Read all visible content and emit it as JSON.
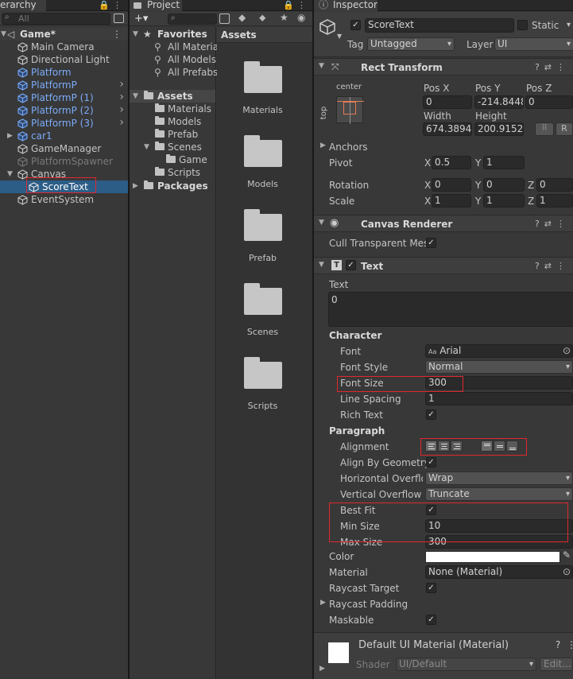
{
  "hierarchy": {
    "tab_label": "erarchy",
    "search_placeholder": "All",
    "scene_name": "Game*",
    "items": [
      {
        "label": "Main Camera",
        "style": "normal"
      },
      {
        "label": "Directional Light",
        "style": "normal"
      },
      {
        "label": "Platform",
        "style": "blue"
      },
      {
        "label": "PlatformP",
        "style": "blue"
      },
      {
        "label": "PlatformP (1)",
        "style": "blue"
      },
      {
        "label": "PlatformP (2)",
        "style": "blue"
      },
      {
        "label": "PlatformP (3)",
        "style": "blue"
      },
      {
        "label": "car1",
        "style": "blue"
      },
      {
        "label": "GameManager",
        "style": "normal"
      },
      {
        "label": "PlatformSpawner",
        "style": "grey"
      },
      {
        "label": "Canvas",
        "style": "normal"
      },
      {
        "label": "ScoreText",
        "style": "selected"
      },
      {
        "label": "EventSystem",
        "style": "normal"
      }
    ]
  },
  "project": {
    "tab_label": "Project",
    "add_label": "+▾",
    "favorites_label": "Favorites",
    "favorites": [
      "All Materia",
      "All Models",
      "All Prefabs"
    ],
    "assets_label": "Assets",
    "asset_folders": [
      "Materials",
      "Models",
      "Prefab",
      "Scenes",
      "Game",
      "Scripts"
    ],
    "packages_label": "Packages",
    "breadcrumb": "Assets",
    "grid_folders": [
      "Materials",
      "Models",
      "Prefab",
      "Scenes",
      "Scripts"
    ]
  },
  "inspector": {
    "tab_label": "Inspector",
    "object_name": "ScoreText",
    "static_label": "Static",
    "tag_label": "Tag",
    "tag_value": "Untagged",
    "layer_label": "Layer",
    "layer_value": "UI",
    "rect_transform": {
      "title": "Rect Transform",
      "anchor_h": "center",
      "anchor_v": "top",
      "posx_label": "Pos X",
      "posx": "0",
      "posy_label": "Pos Y",
      "posy": "-214.8448",
      "posz_label": "Pos Z",
      "posz": "0",
      "width_label": "Width",
      "width": "674.3894",
      "height_label": "Height",
      "height": "200.9152",
      "r_label": "R",
      "anchors_label": "Anchors",
      "pivot_label": "Pivot",
      "pivot_x": "0.5",
      "pivot_y": "1",
      "rotation_label": "Rotation",
      "rot_x": "0",
      "rot_y": "0",
      "rot_z": "0",
      "scale_label": "Scale",
      "scale_x": "1",
      "scale_y": "1",
      "scale_z": "1",
      "x": "X",
      "y": "Y",
      "z": "Z"
    },
    "canvas_renderer": {
      "title": "Canvas Renderer",
      "cull_label": "Cull Transparent Mes"
    },
    "text": {
      "title": "Text",
      "text_label": "Text",
      "text_value": "0",
      "character_label": "Character",
      "font_label": "Font",
      "font_value": "Arial",
      "font_style_label": "Font Style",
      "font_style_value": "Normal",
      "font_size_label": "Font Size",
      "font_size_value": "300",
      "line_spacing_label": "Line Spacing",
      "line_spacing_value": "1",
      "rich_text_label": "Rich Text",
      "paragraph_label": "Paragraph",
      "alignment_label": "Alignment",
      "align_geometry_label": "Align By Geometry",
      "h_overflow_label": "Horizontal Overflow",
      "h_overflow_value": "Wrap",
      "v_overflow_label": "Vertical Overflow",
      "v_overflow_value": "Truncate",
      "best_fit_label": "Best Fit",
      "min_size_label": "Min Size",
      "min_size_value": "10",
      "max_size_label": "Max Size",
      "max_size_value": "300",
      "color_label": "Color",
      "material_label": "Material",
      "material_value": "None (Material)",
      "raycast_target_label": "Raycast Target",
      "raycast_padding_label": "Raycast Padding",
      "maskable_label": "Maskable"
    },
    "material": {
      "name": "Default UI Material (Material)",
      "shader_label": "Shader",
      "shader_value": "UI/Default",
      "edit_label": "Edit..."
    }
  }
}
